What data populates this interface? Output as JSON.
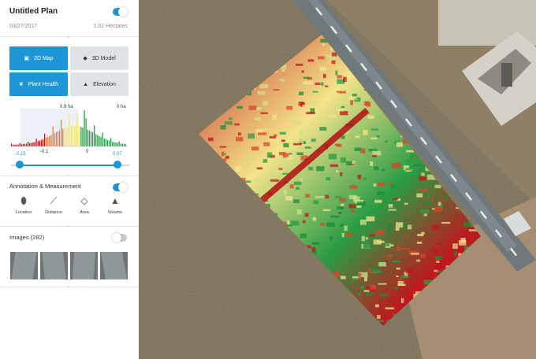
{
  "plan": {
    "title": "Untitled Plan",
    "date": "03/27/2017",
    "area": "1.02 Hectares",
    "enabled": true
  },
  "view_modes": [
    {
      "label": "2D Map",
      "icon": "map-icon",
      "active": true
    },
    {
      "label": "3D Model",
      "icon": "cube-icon",
      "active": false
    },
    {
      "label": "Plant Health",
      "icon": "leaf-icon",
      "active": true
    },
    {
      "label": "Elevation",
      "icon": "mountain-icon",
      "active": false
    }
  ],
  "histogram": {
    "top_label_left": "0.9 ha",
    "top_label_right": "0 ha",
    "ticks": [
      "-0.15",
      "-0.1",
      "0",
      "0.07"
    ],
    "range_min": -0.15,
    "range_max": 0.07
  },
  "annotation": {
    "title": "Annotation & Measurement",
    "enabled": true,
    "tools": [
      {
        "label": "Location",
        "icon": "pin-icon"
      },
      {
        "label": "Distance",
        "icon": "ruler-icon"
      },
      {
        "label": "Area",
        "icon": "polygon-icon"
      },
      {
        "label": "Volume",
        "icon": "cone-icon"
      }
    ]
  },
  "images": {
    "title": "Images (282)",
    "enabled": false
  },
  "colors": {
    "accent": "#1e95d4",
    "health_low": "#c0171d",
    "health_mid": "#f3e48a",
    "health_high": "#1a8c3a"
  }
}
